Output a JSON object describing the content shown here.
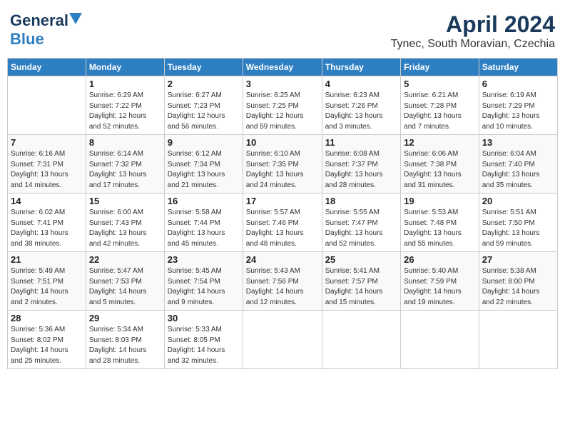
{
  "header": {
    "logo_line1": "General",
    "logo_line2": "Blue",
    "month_year": "April 2024",
    "location": "Tynec, South Moravian, Czechia"
  },
  "weekdays": [
    "Sunday",
    "Monday",
    "Tuesday",
    "Wednesday",
    "Thursday",
    "Friday",
    "Saturday"
  ],
  "weeks": [
    [
      {
        "day": "",
        "detail": ""
      },
      {
        "day": "1",
        "detail": "Sunrise: 6:29 AM\nSunset: 7:22 PM\nDaylight: 12 hours\nand 52 minutes."
      },
      {
        "day": "2",
        "detail": "Sunrise: 6:27 AM\nSunset: 7:23 PM\nDaylight: 12 hours\nand 56 minutes."
      },
      {
        "day": "3",
        "detail": "Sunrise: 6:25 AM\nSunset: 7:25 PM\nDaylight: 12 hours\nand 59 minutes."
      },
      {
        "day": "4",
        "detail": "Sunrise: 6:23 AM\nSunset: 7:26 PM\nDaylight: 13 hours\nand 3 minutes."
      },
      {
        "day": "5",
        "detail": "Sunrise: 6:21 AM\nSunset: 7:28 PM\nDaylight: 13 hours\nand 7 minutes."
      },
      {
        "day": "6",
        "detail": "Sunrise: 6:19 AM\nSunset: 7:29 PM\nDaylight: 13 hours\nand 10 minutes."
      }
    ],
    [
      {
        "day": "7",
        "detail": "Sunrise: 6:16 AM\nSunset: 7:31 PM\nDaylight: 13 hours\nand 14 minutes."
      },
      {
        "day": "8",
        "detail": "Sunrise: 6:14 AM\nSunset: 7:32 PM\nDaylight: 13 hours\nand 17 minutes."
      },
      {
        "day": "9",
        "detail": "Sunrise: 6:12 AM\nSunset: 7:34 PM\nDaylight: 13 hours\nand 21 minutes."
      },
      {
        "day": "10",
        "detail": "Sunrise: 6:10 AM\nSunset: 7:35 PM\nDaylight: 13 hours\nand 24 minutes."
      },
      {
        "day": "11",
        "detail": "Sunrise: 6:08 AM\nSunset: 7:37 PM\nDaylight: 13 hours\nand 28 minutes."
      },
      {
        "day": "12",
        "detail": "Sunrise: 6:06 AM\nSunset: 7:38 PM\nDaylight: 13 hours\nand 31 minutes."
      },
      {
        "day": "13",
        "detail": "Sunrise: 6:04 AM\nSunset: 7:40 PM\nDaylight: 13 hours\nand 35 minutes."
      }
    ],
    [
      {
        "day": "14",
        "detail": "Sunrise: 6:02 AM\nSunset: 7:41 PM\nDaylight: 13 hours\nand 38 minutes."
      },
      {
        "day": "15",
        "detail": "Sunrise: 6:00 AM\nSunset: 7:43 PM\nDaylight: 13 hours\nand 42 minutes."
      },
      {
        "day": "16",
        "detail": "Sunrise: 5:58 AM\nSunset: 7:44 PM\nDaylight: 13 hours\nand 45 minutes."
      },
      {
        "day": "17",
        "detail": "Sunrise: 5:57 AM\nSunset: 7:46 PM\nDaylight: 13 hours\nand 48 minutes."
      },
      {
        "day": "18",
        "detail": "Sunrise: 5:55 AM\nSunset: 7:47 PM\nDaylight: 13 hours\nand 52 minutes."
      },
      {
        "day": "19",
        "detail": "Sunrise: 5:53 AM\nSunset: 7:48 PM\nDaylight: 13 hours\nand 55 minutes."
      },
      {
        "day": "20",
        "detail": "Sunrise: 5:51 AM\nSunset: 7:50 PM\nDaylight: 13 hours\nand 59 minutes."
      }
    ],
    [
      {
        "day": "21",
        "detail": "Sunrise: 5:49 AM\nSunset: 7:51 PM\nDaylight: 14 hours\nand 2 minutes."
      },
      {
        "day": "22",
        "detail": "Sunrise: 5:47 AM\nSunset: 7:53 PM\nDaylight: 14 hours\nand 5 minutes."
      },
      {
        "day": "23",
        "detail": "Sunrise: 5:45 AM\nSunset: 7:54 PM\nDaylight: 14 hours\nand 9 minutes."
      },
      {
        "day": "24",
        "detail": "Sunrise: 5:43 AM\nSunset: 7:56 PM\nDaylight: 14 hours\nand 12 minutes."
      },
      {
        "day": "25",
        "detail": "Sunrise: 5:41 AM\nSunset: 7:57 PM\nDaylight: 14 hours\nand 15 minutes."
      },
      {
        "day": "26",
        "detail": "Sunrise: 5:40 AM\nSunset: 7:59 PM\nDaylight: 14 hours\nand 19 minutes."
      },
      {
        "day": "27",
        "detail": "Sunrise: 5:38 AM\nSunset: 8:00 PM\nDaylight: 14 hours\nand 22 minutes."
      }
    ],
    [
      {
        "day": "28",
        "detail": "Sunrise: 5:36 AM\nSunset: 8:02 PM\nDaylight: 14 hours\nand 25 minutes."
      },
      {
        "day": "29",
        "detail": "Sunrise: 5:34 AM\nSunset: 8:03 PM\nDaylight: 14 hours\nand 28 minutes."
      },
      {
        "day": "30",
        "detail": "Sunrise: 5:33 AM\nSunset: 8:05 PM\nDaylight: 14 hours\nand 32 minutes."
      },
      {
        "day": "",
        "detail": ""
      },
      {
        "day": "",
        "detail": ""
      },
      {
        "day": "",
        "detail": ""
      },
      {
        "day": "",
        "detail": ""
      }
    ]
  ]
}
